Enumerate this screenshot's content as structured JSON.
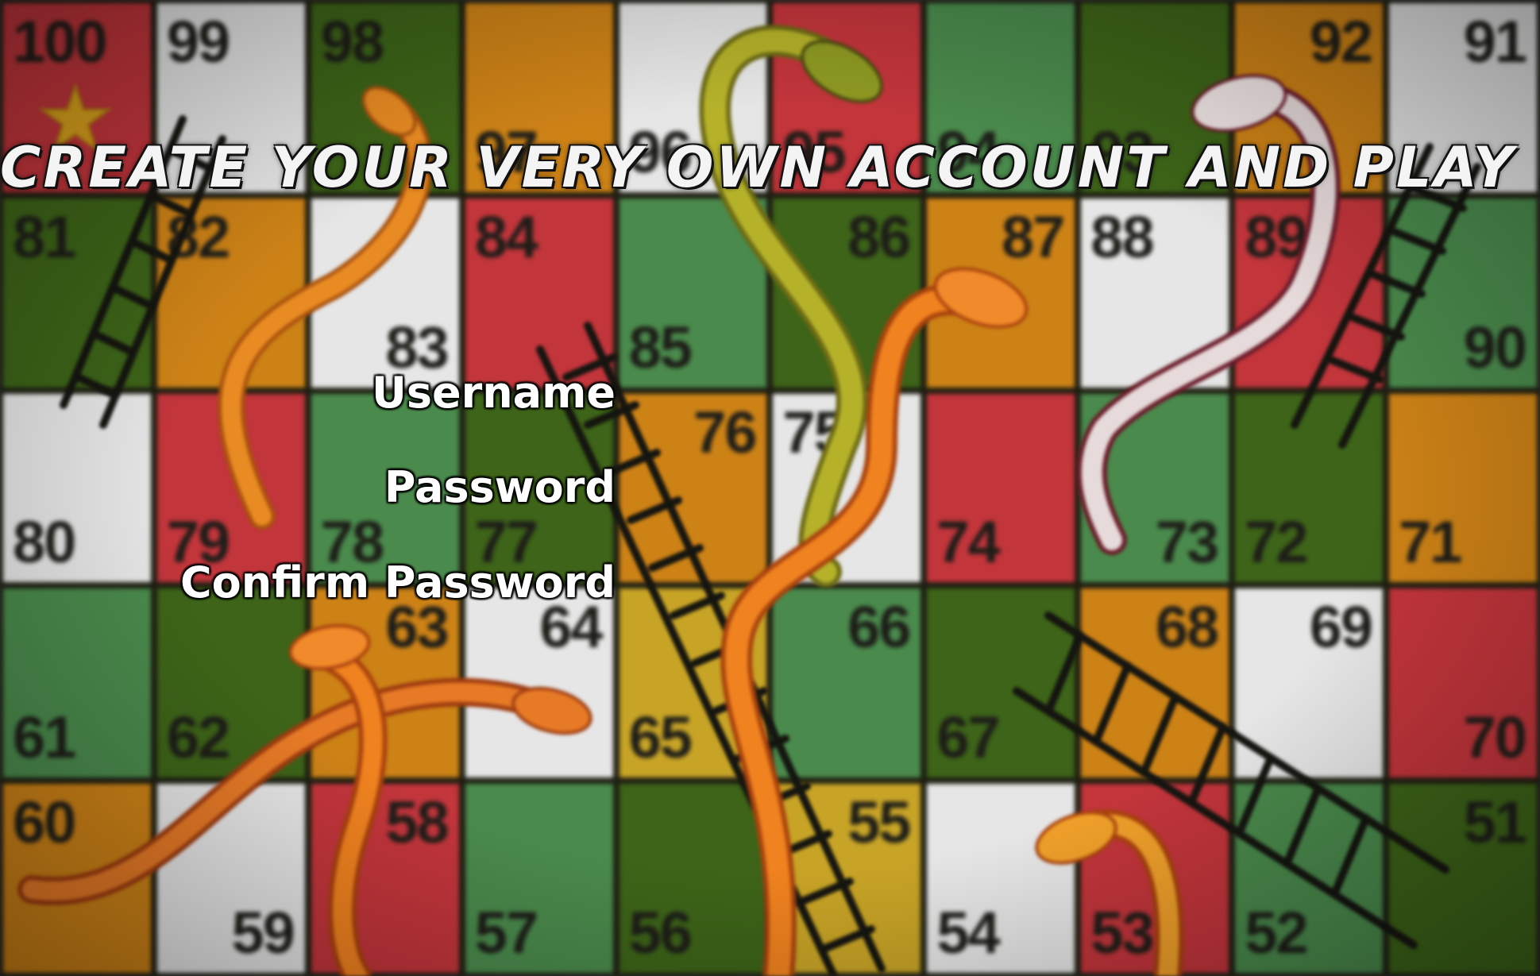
{
  "title": "CREATE YOUR VERY OWN ACCOUNT AND PLAY !",
  "form": {
    "username_label": "Username",
    "password_label": "Password",
    "confirm_password_label": "Confirm Password"
  },
  "board": {
    "rows": [
      [
        {
          "n": "100",
          "c": "red",
          "p": "tl"
        },
        {
          "n": "99",
          "c": "white",
          "p": "tl"
        },
        {
          "n": "98",
          "c": "dkgreen",
          "p": "tl"
        },
        {
          "n": "97",
          "c": "orange",
          "p": "bl"
        },
        {
          "n": "96",
          "c": "white",
          "p": "bl"
        },
        {
          "n": "95",
          "c": "red",
          "p": "bl"
        },
        {
          "n": "94",
          "c": "green",
          "p": "bl"
        },
        {
          "n": "93",
          "c": "dkgreen",
          "p": "bl"
        },
        {
          "n": "92",
          "c": "orange",
          "p": "tr"
        },
        {
          "n": "91",
          "c": "white",
          "p": "tr"
        }
      ],
      [
        {
          "n": "81",
          "c": "dkgreen",
          "p": "tl"
        },
        {
          "n": "82",
          "c": "orange",
          "p": "tl"
        },
        {
          "n": "83",
          "c": "white",
          "p": "br"
        },
        {
          "n": "84",
          "c": "red",
          "p": "tl"
        },
        {
          "n": "85",
          "c": "green",
          "p": "bl"
        },
        {
          "n": "86",
          "c": "dkgreen",
          "p": "tr"
        },
        {
          "n": "87",
          "c": "orange",
          "p": "tr"
        },
        {
          "n": "88",
          "c": "white",
          "p": "tl"
        },
        {
          "n": "89",
          "c": "red",
          "p": "tl"
        },
        {
          "n": "90",
          "c": "green",
          "p": "br"
        }
      ],
      [
        {
          "n": "80",
          "c": "white",
          "p": "bl"
        },
        {
          "n": "79",
          "c": "red",
          "p": "bl"
        },
        {
          "n": "78",
          "c": "green",
          "p": "bl"
        },
        {
          "n": "77",
          "c": "dkgreen",
          "p": "bl"
        },
        {
          "n": "76",
          "c": "orange",
          "p": "tr"
        },
        {
          "n": "75",
          "c": "white",
          "p": "tl"
        },
        {
          "n": "74",
          "c": "red",
          "p": "bl"
        },
        {
          "n": "73",
          "c": "green",
          "p": "br"
        },
        {
          "n": "72",
          "c": "dkgreen",
          "p": "bl"
        },
        {
          "n": "71",
          "c": "orange",
          "p": "bl"
        }
      ],
      [
        {
          "n": "61",
          "c": "green",
          "p": "bl"
        },
        {
          "n": "62",
          "c": "dkgreen",
          "p": "bl"
        },
        {
          "n": "63",
          "c": "orange",
          "p": "tr"
        },
        {
          "n": "64",
          "c": "white",
          "p": "tr"
        },
        {
          "n": "65",
          "c": "yellow",
          "p": "bl"
        },
        {
          "n": "66",
          "c": "green",
          "p": "tr"
        },
        {
          "n": "67",
          "c": "dkgreen",
          "p": "bl"
        },
        {
          "n": "68",
          "c": "orange",
          "p": "tr"
        },
        {
          "n": "69",
          "c": "white",
          "p": "tr"
        },
        {
          "n": "70",
          "c": "red",
          "p": "br"
        }
      ],
      [
        {
          "n": "60",
          "c": "orange",
          "p": "tl"
        },
        {
          "n": "59",
          "c": "white",
          "p": "br"
        },
        {
          "n": "58",
          "c": "red",
          "p": "tr"
        },
        {
          "n": "57",
          "c": "green",
          "p": "bl"
        },
        {
          "n": "56",
          "c": "dkgreen",
          "p": "bl"
        },
        {
          "n": "55",
          "c": "yellow",
          "p": "tr"
        },
        {
          "n": "54",
          "c": "white",
          "p": "bl"
        },
        {
          "n": "53",
          "c": "red",
          "p": "bl"
        },
        {
          "n": "52",
          "c": "green",
          "p": "bl"
        },
        {
          "n": "51",
          "c": "dkgreen",
          "p": "tr"
        }
      ]
    ]
  },
  "colors": {
    "red": "#c2353b",
    "white": "#e6e6e6",
    "dkgreen": "#3d6418",
    "orange": "#cd8216",
    "green": "#4a8a4c",
    "yellow": "#c8a426"
  },
  "decorations": [
    "star-icon",
    "snake-icon",
    "ladder-icon"
  ]
}
